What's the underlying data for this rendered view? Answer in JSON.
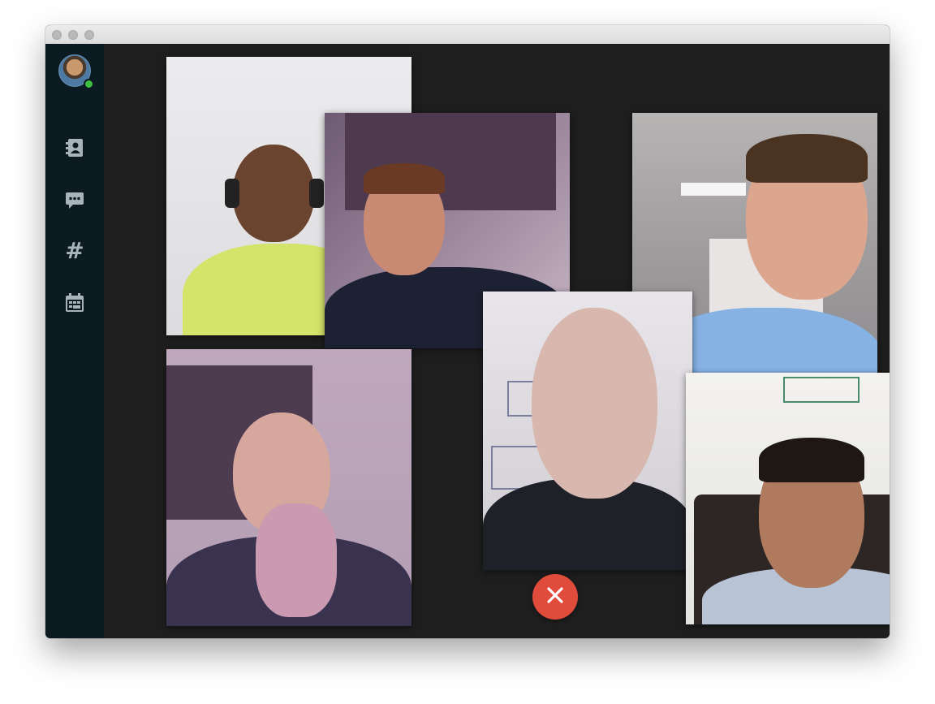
{
  "sidebar": {
    "avatar_status": "online",
    "items": [
      {
        "icon": "contacts-icon"
      },
      {
        "icon": "chat-icon"
      },
      {
        "icon": "channels-hash-icon",
        "glyph": "#"
      },
      {
        "icon": "calendar-icon"
      }
    ]
  },
  "call": {
    "participant_tiles": 6,
    "hangup_icon": "close-icon",
    "colors": {
      "hangup": "#e14b3b",
      "presence": "#3fbf3f",
      "sidebar": "#0c1a22",
      "stage": "#1e1e1e"
    }
  }
}
